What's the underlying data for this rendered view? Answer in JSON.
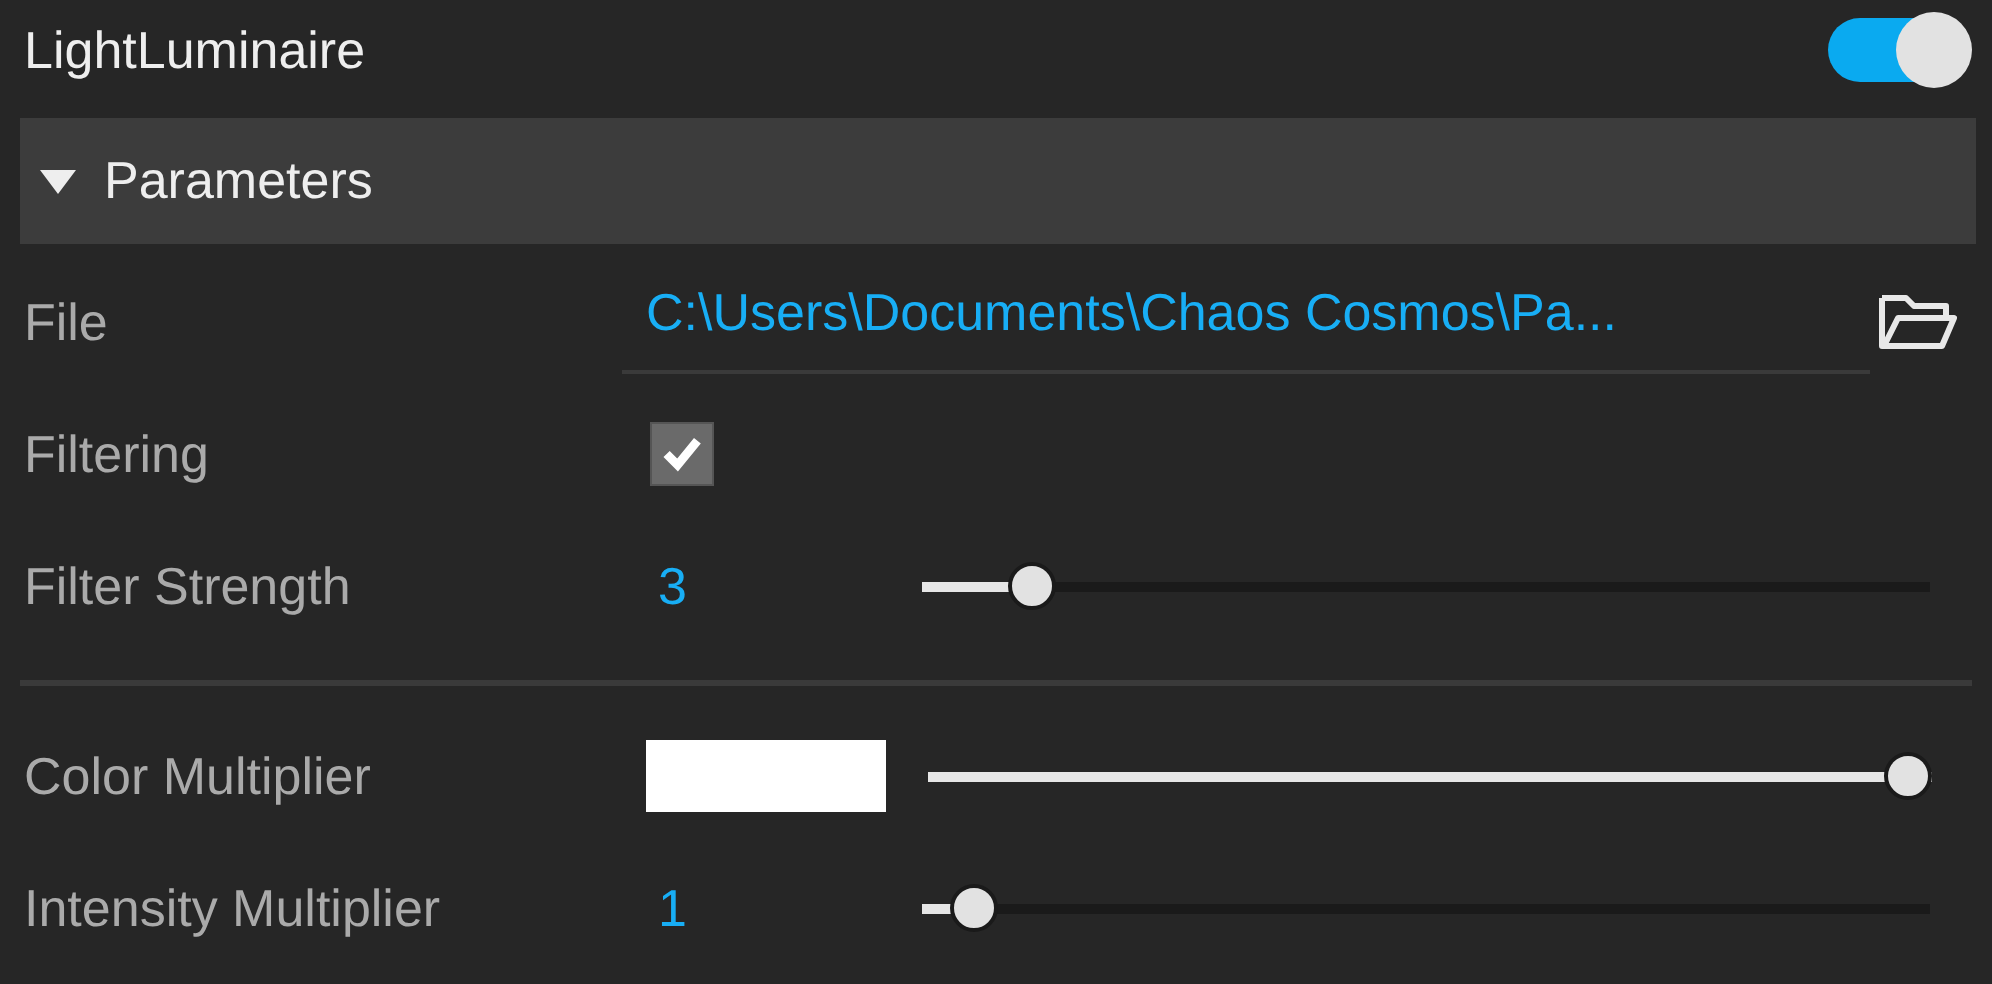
{
  "title": "LightLuminaire",
  "enabled": true,
  "section": {
    "label": "Parameters",
    "expanded": true
  },
  "groups": [
    [
      {
        "kind": "file",
        "label": "File",
        "value": "C:\\Users\\Documents\\Chaos Cosmos\\Pa..."
      },
      {
        "kind": "checkbox",
        "label": "Filtering",
        "checked": true
      },
      {
        "kind": "slider",
        "label": "Filter Strength",
        "value": "3",
        "level": 0.09
      }
    ],
    [
      {
        "kind": "color",
        "label": "Color Multiplier",
        "color": "#ffffff",
        "level": 1
      },
      {
        "kind": "slider",
        "label": "Intensity Multiplier",
        "value": "1",
        "level": 0.03
      }
    ]
  ]
}
